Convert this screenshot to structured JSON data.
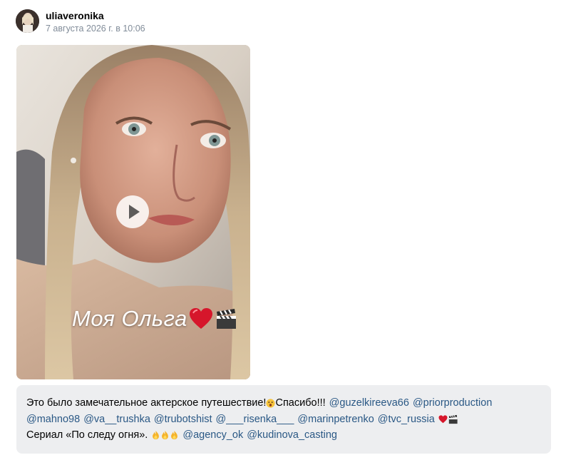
{
  "header": {
    "username": "uliaveronika",
    "timestamp": "7 августа 2026 г. в 10:06"
  },
  "media": {
    "overlay_text": "Моя Ольга",
    "overlay_icons": [
      "heart-icon",
      "clapper-board-icon"
    ],
    "play_icon": "play-icon"
  },
  "caption": {
    "line1_text_a": "Это было замечательное актерское путешествие!",
    "line1_text_b": "Спасибо!!!",
    "line3_text": "Сериал «По следу огня».",
    "mentions": [
      "@guzelkireeva66",
      "@priorproduction",
      "@mahno98",
      "@va__trushka",
      "@trubotshist",
      "@___risenka___",
      "@marinpetrenko",
      "@tvc_russia",
      "@agency_ok",
      "@kudinova_casting"
    ],
    "emoji_icons": [
      "astonished-face-icon",
      "heart-icon",
      "clapper-board-icon",
      "fire-icon"
    ]
  },
  "colors": {
    "mention": "#2a5885",
    "timestamp": "#818c99",
    "caption_background": "#edeef0",
    "heart": "#d6162b"
  }
}
